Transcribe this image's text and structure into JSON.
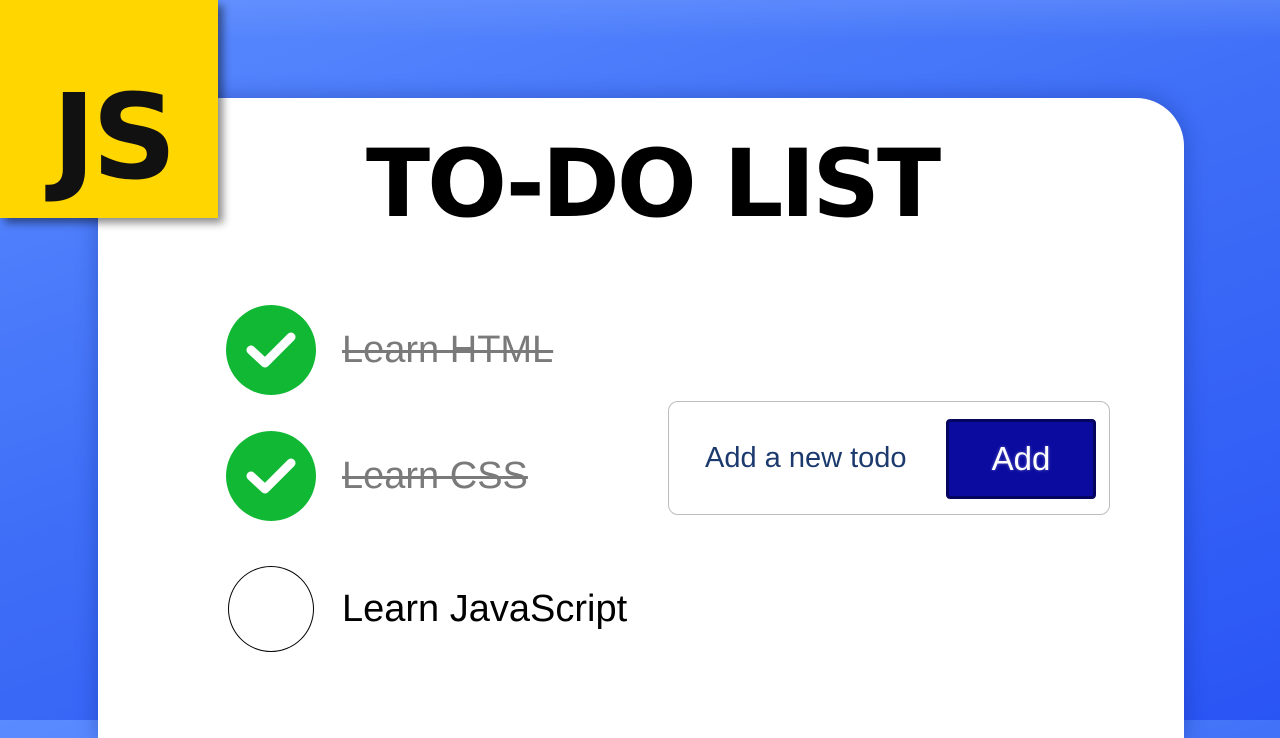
{
  "logo": {
    "text": "JS",
    "color": "#ffd600"
  },
  "title": "TO-DO LIST",
  "todos": [
    {
      "text": "Learn HTML",
      "done": true,
      "icon": "checkmark-icon"
    },
    {
      "text": "Learn CSS",
      "done": true,
      "icon": "checkmark-icon"
    },
    {
      "text": "Learn JavaScript",
      "done": false,
      "icon": "empty-circle-icon"
    }
  ],
  "add_form": {
    "placeholder": "Add a new todo",
    "button_label": "Add"
  },
  "colors": {
    "background": "#3f6ff7",
    "done_green": "#10b834",
    "button_blue": "#0b0ba0"
  }
}
